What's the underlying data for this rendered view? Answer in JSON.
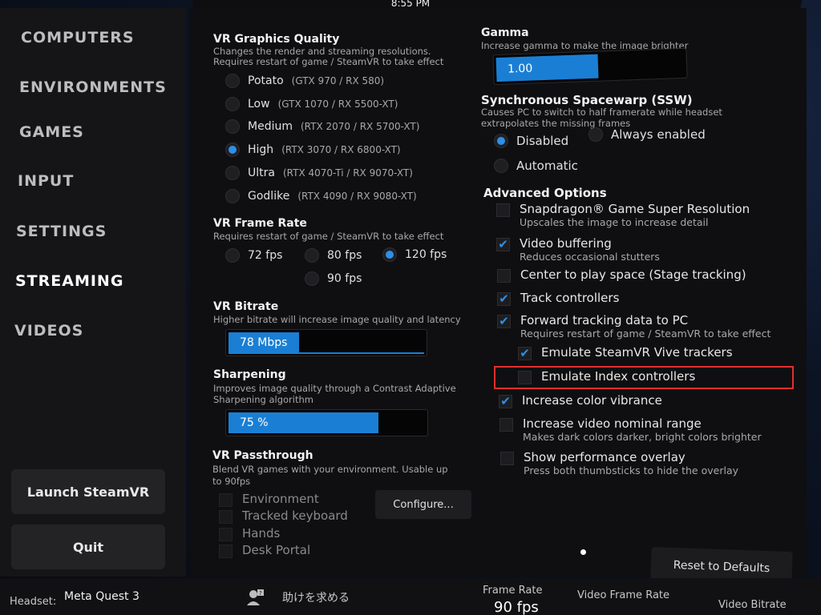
{
  "clock": "8:55 PM",
  "nav": [
    "COMPUTERS",
    "ENVIRONMENTS",
    "GAMES",
    "INPUT",
    "SETTINGS",
    "STREAMING",
    "VIDEOS"
  ],
  "nav_active": "STREAMING",
  "sidebar_buttons": {
    "launch": "Launch SteamVR",
    "quit": "Quit"
  },
  "graphics": {
    "title": "VR Graphics Quality",
    "desc1": "Changes the render and streaming resolutions.",
    "desc2": "Requires restart of game / SteamVR to take effect",
    "options": [
      {
        "label": "Potato",
        "gpu": "(GTX 970 / RX 580)"
      },
      {
        "label": "Low",
        "gpu": "(GTX 1070 / RX 5500-XT)"
      },
      {
        "label": "Medium",
        "gpu": "(RTX 2070 / RX 5700-XT)"
      },
      {
        "label": "High",
        "gpu": "(RTX 3070 / RX 6800-XT)"
      },
      {
        "label": "Ultra",
        "gpu": "(RTX 4070-Ti / RX 9070-XT)"
      },
      {
        "label": "Godlike",
        "gpu": "(RTX 4090 / RX 9080-XT)"
      }
    ],
    "selected": "High"
  },
  "framerate": {
    "title": "VR Frame Rate",
    "desc": "Requires restart of game / SteamVR to take effect",
    "options": [
      "72 fps",
      "80 fps",
      "120 fps",
      "90 fps"
    ],
    "selected": "120 fps"
  },
  "bitrate": {
    "title": "VR Bitrate",
    "desc": "Higher bitrate will increase image quality and latency",
    "value": "78 Mbps",
    "fill": 0.36
  },
  "sharpening": {
    "title": "Sharpening",
    "desc1": "Improves image quality through a Contrast Adaptive",
    "desc2": "Sharpening algorithm",
    "value": "75 %",
    "fill": 0.75
  },
  "passthrough": {
    "title": "VR Passthrough",
    "desc1": "Blend VR games with your environment. Usable up",
    "desc2": "to 90fps",
    "options": [
      "Environment",
      "Tracked keyboard",
      "Hands",
      "Desk Portal"
    ],
    "configure": "Configure..."
  },
  "gamma": {
    "title": "Gamma",
    "desc": "Increase gamma to make the image brighter",
    "value": "1.00",
    "fill": 0.5
  },
  "ssw": {
    "title": "Synchronous Spacewarp (SSW)",
    "desc1": "Causes PC to switch to half framerate while headset",
    "desc2": "extrapolates the missing frames",
    "disabled": "Disabled",
    "always": "Always enabled",
    "automatic": "Automatic",
    "selected": "Disabled"
  },
  "advanced": {
    "title": "Advanced Options",
    "items": [
      {
        "label": "Snapdragon® Game Super Resolution",
        "sub": "Upscales the image to increase detail",
        "checked": false
      },
      {
        "label": "Video buffering",
        "sub": "Reduces occasional stutters",
        "checked": true
      },
      {
        "label": "Center to play space (Stage tracking)",
        "sub": "",
        "checked": false
      },
      {
        "label": "Track controllers",
        "sub": "",
        "checked": true
      },
      {
        "label": "Forward tracking data to PC",
        "sub": "Requires restart of game / SteamVR to take effect",
        "checked": true
      },
      {
        "label": "Emulate SteamVR Vive trackers",
        "sub": "",
        "checked": true
      },
      {
        "label": "Emulate Index controllers",
        "sub": "",
        "checked": false
      },
      {
        "label": "Increase color vibrance",
        "sub": "",
        "checked": true
      },
      {
        "label": "Increase video nominal range",
        "sub": "Makes dark colors darker, bright colors brighter",
        "checked": false
      },
      {
        "label": "Show performance overlay",
        "sub": "Press both thumbsticks to hide the overlay",
        "checked": false
      }
    ]
  },
  "reset": "Reset to Defaults",
  "bottom": {
    "headset_label": "Headset:",
    "headset_value": "Meta Quest 3",
    "help": "助けを求める",
    "framerate_label": "Frame Rate",
    "framerate_value": "90 fps",
    "video_framerate_label": "Video Frame Rate",
    "video_bitrate_label": "Video Bitrate"
  },
  "colors": {
    "accent": "#1a7fd4",
    "highlight": "#e0302e"
  }
}
